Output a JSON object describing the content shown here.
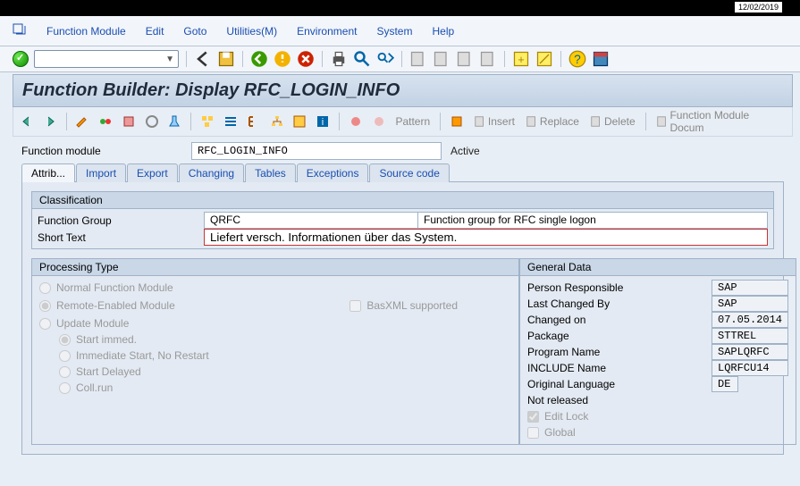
{
  "top_date": "12/02/2019",
  "menu": {
    "function_module": "Function Module",
    "edit": "Edit",
    "goto": "Goto",
    "utilities": "Utilities(M)",
    "environment": "Environment",
    "system": "System",
    "help": "Help"
  },
  "title": "Function Builder: Display RFC_LOGIN_INFO",
  "toolbar2": {
    "pattern": "Pattern",
    "insert": "Insert",
    "replace": "Replace",
    "delete": "Delete",
    "fm_doc": "Function Module Docum"
  },
  "form": {
    "fm_label": "Function module",
    "fm_value": "RFC_LOGIN_INFO",
    "active": "Active"
  },
  "tabs": {
    "attrib": "Attrib...",
    "import": "Import",
    "export": "Export",
    "changing": "Changing",
    "tables": "Tables",
    "exceptions": "Exceptions",
    "source": "Source code"
  },
  "classification": {
    "group_title": "Classification",
    "fg_label": "Function Group",
    "fg_value": "QRFC",
    "fg_desc": "Function group for RFC single logon",
    "st_label": "Short Text",
    "st_value": "Liefert versch. Informationen über das System."
  },
  "processing": {
    "title": "Processing Type",
    "normal": "Normal Function Module",
    "remote": "Remote-Enabled Module",
    "basxml": "BasXML supported",
    "update": "Update Module",
    "start_immed": "Start immed.",
    "immed_no_restart": "Immediate Start, No Restart",
    "start_delayed": "Start Delayed",
    "coll_run": "Coll.run"
  },
  "general": {
    "title": "General Data",
    "person_resp_label": "Person Responsible",
    "person_resp": "SAP",
    "last_changed_label": "Last Changed By",
    "last_changed": "SAP",
    "changed_on_label": "Changed on",
    "changed_on": "07.05.2014",
    "package_label": "Package",
    "package": "STTREL",
    "program_label": "Program Name",
    "program": "SAPLQRFC",
    "include_label": "INCLUDE Name",
    "include": "LQRFCU14",
    "orig_lang_label": "Original Language",
    "orig_lang": "DE",
    "not_released": "Not released",
    "edit_lock": "Edit Lock",
    "global": "Global"
  }
}
